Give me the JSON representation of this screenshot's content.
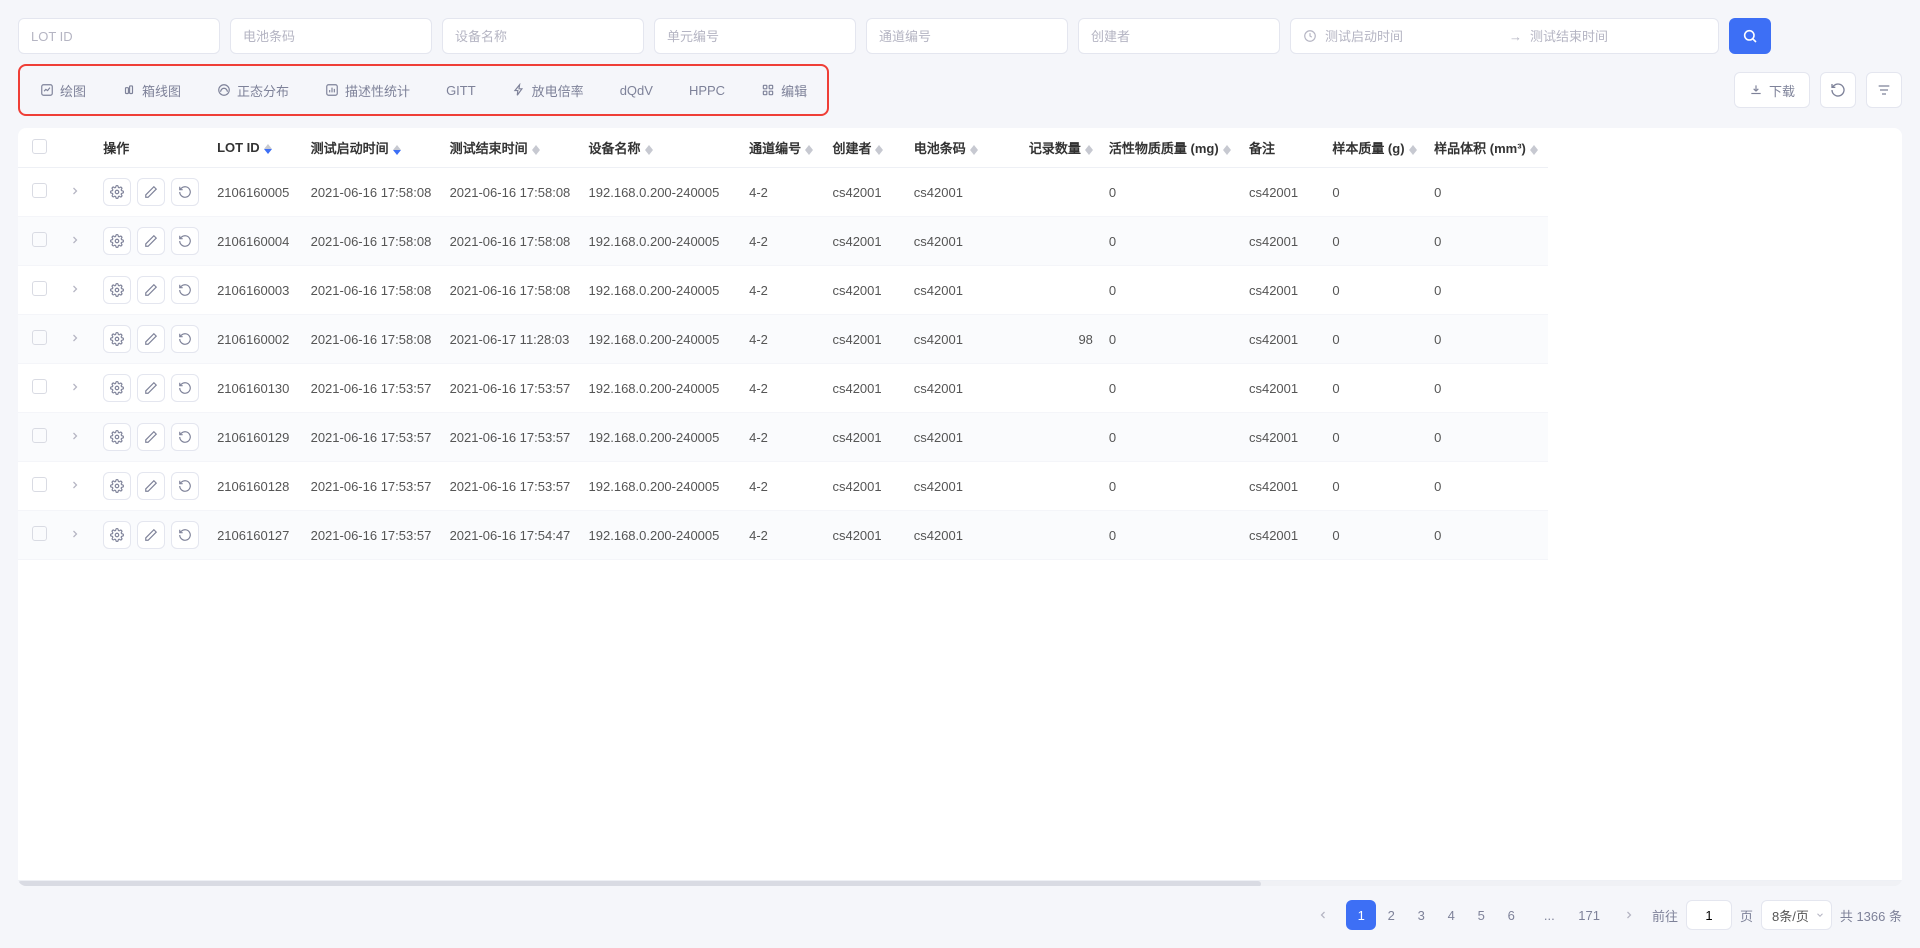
{
  "filters": {
    "lot_id": {
      "placeholder": "LOT ID"
    },
    "battery_code": {
      "placeholder": "电池条码"
    },
    "device_name": {
      "placeholder": "设备名称"
    },
    "unit_no": {
      "placeholder": "单元编号"
    },
    "channel_no": {
      "placeholder": "通道编号"
    },
    "creator": {
      "placeholder": "创建者"
    },
    "daterange": {
      "start_placeholder": "测试启动时间",
      "end_placeholder": "测试结束时间",
      "separator": "→"
    }
  },
  "toolbar": {
    "draw": "绘图",
    "boxplot": "箱线图",
    "normal_dist": "正态分布",
    "descriptive": "描述性统计",
    "gitt": "GITT",
    "discharge_rate": "放电倍率",
    "dqdv": "dQdV",
    "hppc": "HPPC",
    "edit": "编辑",
    "download": "下载"
  },
  "columns": {
    "operation": "操作",
    "lot_id": "LOT ID",
    "start_time": "测试启动时间",
    "end_time": "测试结束时间",
    "device_name": "设备名称",
    "channel_no": "通道编号",
    "creator": "创建者",
    "battery_code": "电池条码",
    "record_count": "记录数量",
    "active_mass": "活性物质质量 (mg)",
    "remark": "备注",
    "sample_mass": "样本质量 (g)",
    "sample_volume": "样品体积 (mm³)"
  },
  "rows": [
    {
      "lot_id": "2106160005",
      "start_time": "2021-06-16 17:58:08",
      "end_time": "2021-06-16 17:58:08",
      "device_name": "192.168.0.200-240005",
      "channel_no": "4-2",
      "creator": "cs42001",
      "battery_code": "cs42001",
      "record_count": "",
      "active_mass": "0",
      "remark": "cs42001",
      "sample_mass": "0",
      "sample_volume": "0"
    },
    {
      "lot_id": "2106160004",
      "start_time": "2021-06-16 17:58:08",
      "end_time": "2021-06-16 17:58:08",
      "device_name": "192.168.0.200-240005",
      "channel_no": "4-2",
      "creator": "cs42001",
      "battery_code": "cs42001",
      "record_count": "",
      "active_mass": "0",
      "remark": "cs42001",
      "sample_mass": "0",
      "sample_volume": "0"
    },
    {
      "lot_id": "2106160003",
      "start_time": "2021-06-16 17:58:08",
      "end_time": "2021-06-16 17:58:08",
      "device_name": "192.168.0.200-240005",
      "channel_no": "4-2",
      "creator": "cs42001",
      "battery_code": "cs42001",
      "record_count": "",
      "active_mass": "0",
      "remark": "cs42001",
      "sample_mass": "0",
      "sample_volume": "0"
    },
    {
      "lot_id": "2106160002",
      "start_time": "2021-06-16 17:58:08",
      "end_time": "2021-06-17 11:28:03",
      "device_name": "192.168.0.200-240005",
      "channel_no": "4-2",
      "creator": "cs42001",
      "battery_code": "cs42001",
      "record_count": "98",
      "active_mass": "0",
      "remark": "cs42001",
      "sample_mass": "0",
      "sample_volume": "0"
    },
    {
      "lot_id": "2106160130",
      "start_time": "2021-06-16 17:53:57",
      "end_time": "2021-06-16 17:53:57",
      "device_name": "192.168.0.200-240005",
      "channel_no": "4-2",
      "creator": "cs42001",
      "battery_code": "cs42001",
      "record_count": "",
      "active_mass": "0",
      "remark": "cs42001",
      "sample_mass": "0",
      "sample_volume": "0"
    },
    {
      "lot_id": "2106160129",
      "start_time": "2021-06-16 17:53:57",
      "end_time": "2021-06-16 17:53:57",
      "device_name": "192.168.0.200-240005",
      "channel_no": "4-2",
      "creator": "cs42001",
      "battery_code": "cs42001",
      "record_count": "",
      "active_mass": "0",
      "remark": "cs42001",
      "sample_mass": "0",
      "sample_volume": "0"
    },
    {
      "lot_id": "2106160128",
      "start_time": "2021-06-16 17:53:57",
      "end_time": "2021-06-16 17:53:57",
      "device_name": "192.168.0.200-240005",
      "channel_no": "4-2",
      "creator": "cs42001",
      "battery_code": "cs42001",
      "record_count": "",
      "active_mass": "0",
      "remark": "cs42001",
      "sample_mass": "0",
      "sample_volume": "0"
    },
    {
      "lot_id": "2106160127",
      "start_time": "2021-06-16 17:53:57",
      "end_time": "2021-06-16 17:54:47",
      "device_name": "192.168.0.200-240005",
      "channel_no": "4-2",
      "creator": "cs42001",
      "battery_code": "cs42001",
      "record_count": "",
      "active_mass": "0",
      "remark": "cs42001",
      "sample_mass": "0",
      "sample_volume": "0"
    }
  ],
  "pagination": {
    "pages": [
      "1",
      "2",
      "3",
      "4",
      "5",
      "6"
    ],
    "ellipsis": "...",
    "last": "171",
    "goto_label": "前往",
    "goto_value": "1",
    "page_suffix": "页",
    "per_page": "8条/页",
    "total": "共 1366 条",
    "active": 0
  }
}
